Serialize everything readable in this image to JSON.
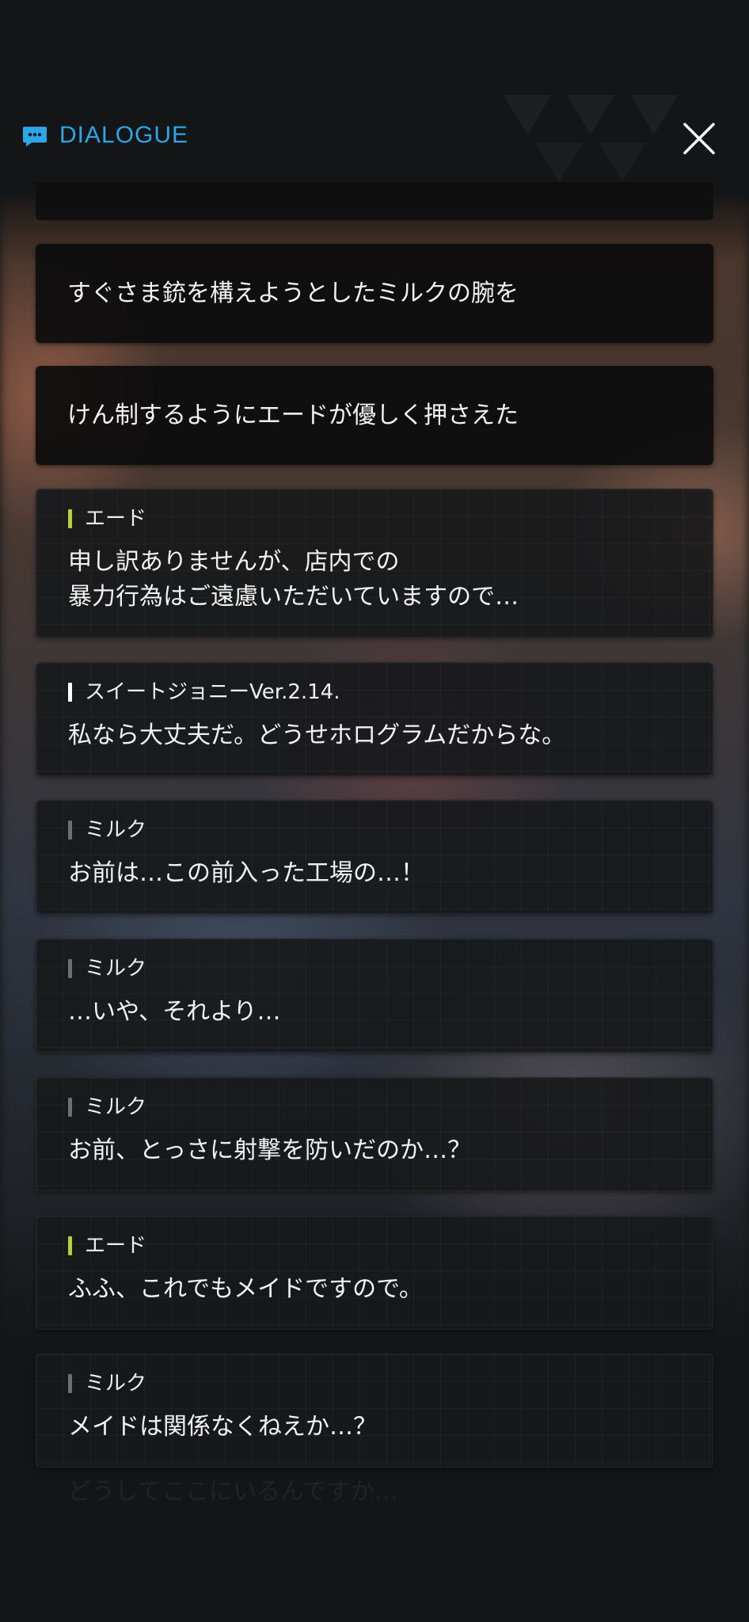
{
  "header": {
    "title": "DIALOGUE"
  },
  "colors": {
    "accent": "#2aa7e6",
    "speaker_ed": "#b5d336",
    "speaker_johnny": "#ffffff",
    "speaker_milk": "#6f6f6f"
  },
  "icons": {
    "header": "chat-bubble-icon",
    "close": "close-icon"
  },
  "entries": [
    {
      "type": "narration",
      "text": "すぐさま銃を構えようとしたミルクの腕を"
    },
    {
      "type": "narration",
      "text": "けん制するようにエードが優しく押さえた"
    },
    {
      "type": "speech",
      "speaker": "エード",
      "lines": [
        "申し訳ありませんが、店内での",
        "暴力行為はご遠慮いただいていますので…"
      ]
    },
    {
      "type": "speech",
      "speaker": "スイートジョニーVer.2.14.",
      "lines": [
        "私なら大丈夫だ。どうせホログラムだからな。"
      ]
    },
    {
      "type": "speech",
      "speaker": "ミルク",
      "lines": [
        "お前は…この前入った工場の…！"
      ]
    },
    {
      "type": "speech",
      "speaker": "ミルク",
      "lines": [
        "…いや、それより…"
      ]
    },
    {
      "type": "speech",
      "speaker": "ミルク",
      "lines": [
        "お前、とっさに射撃を防いだのか…？"
      ]
    },
    {
      "type": "speech",
      "speaker": "エード",
      "lines": [
        "ふふ、これでもメイドですので。"
      ]
    },
    {
      "type": "speech",
      "speaker": "ミルク",
      "lines": [
        "メイドは関係なくねえか…？"
      ]
    }
  ],
  "faded_next_line": "どうしてここにいるんですか…"
}
